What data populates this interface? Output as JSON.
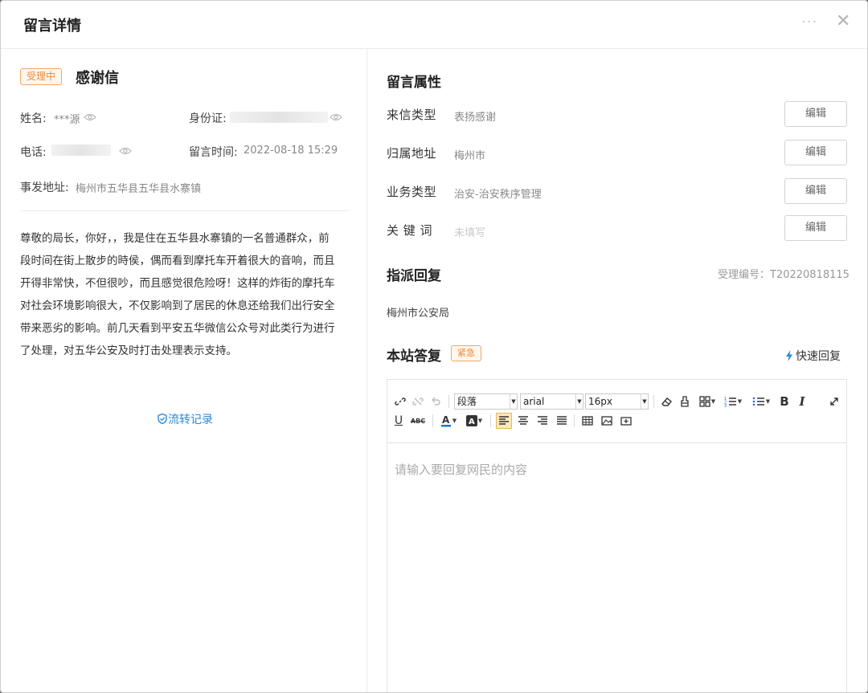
{
  "dialog": {
    "title": "留言详情"
  },
  "message": {
    "status": "受理中",
    "title": "感谢信",
    "name_label": "姓名:",
    "name_value": "***源",
    "id_label": "身份证:",
    "phone_label": "电话:",
    "time_label": "留言时间:",
    "time_value": "2022-08-18 15:29",
    "address_label": "事发地址:",
    "address_value": "梅州市五华县五华县水寨镇",
    "content_lines": [
      "尊敬的局长，你好，，我是住在五华县水寨镇的一名普通群众，前",
      "段时间在街上散步的時侯，偶而看到摩托车开着很大的音响，而且",
      "开得非常快，不但很吵，而且感觉很危险呀！这样的炸街的摩托车",
      "对社会环境影响很大，不仅影响到了居民的休息还给我们出行安全",
      "带来恶劣的影响。前几天看到平安五华微信公众号对此类行为进行",
      "了处理，对五华公安及时打击处理表示支持。"
    ],
    "flow_link": "流转记录"
  },
  "attributes": {
    "section_title": "留言属性",
    "edit_label": "编辑",
    "rows": [
      {
        "label": "来信类型",
        "value": "表扬感谢"
      },
      {
        "label": "归属地址",
        "value": "梅州市"
      },
      {
        "label": "业务类型",
        "value": "治安-治安秩序管理"
      },
      {
        "label": "关 键 词",
        "value": "未填写"
      }
    ]
  },
  "assign": {
    "section_title": "指派回复",
    "accept_no": "受理编号：T20220818115",
    "department": "梅州市公安局"
  },
  "reply": {
    "section_title": "本站答复",
    "urgent_badge": "紧急",
    "quick_reply": "快速回复",
    "placeholder": "请输入要回复网民的内容",
    "toolbar": {
      "paragraph": "段落",
      "font": "arial",
      "size": "16px",
      "bold": "B",
      "italic": "I",
      "underline": "U",
      "strike": "ABC"
    }
  },
  "colors": {
    "accent": "#e88a3a",
    "link": "#2a8ad8"
  }
}
